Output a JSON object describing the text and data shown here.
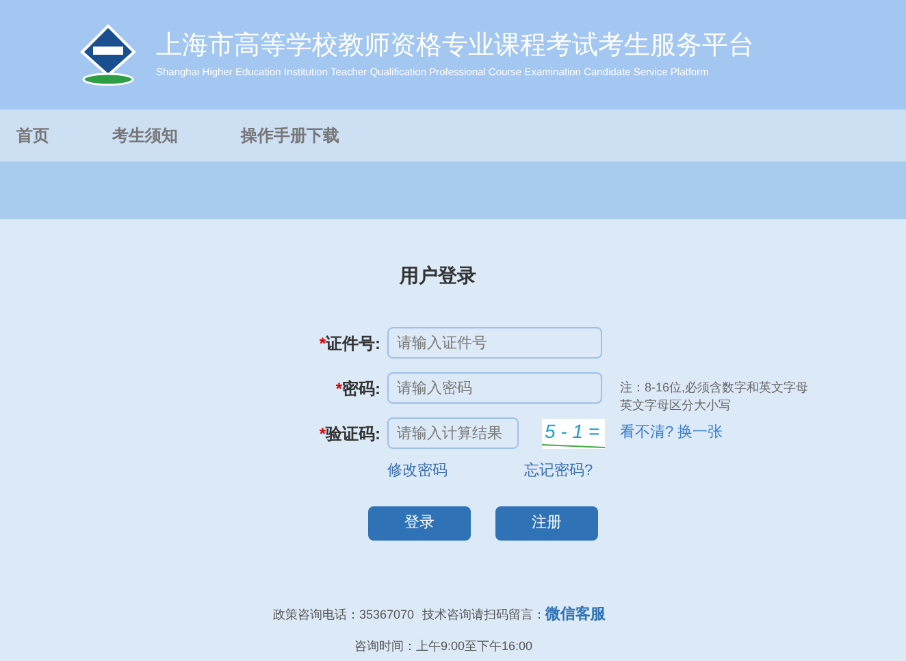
{
  "header": {
    "title": "上海市高等学校教师资格专业课程考试考生服务平台",
    "subtitle": "Shanghai Higher Education Institution Teacher Qualification Professional Course Examination Candidate Service Platform"
  },
  "nav": [
    {
      "label": "首页",
      "selected": false
    },
    {
      "label": "考生须知",
      "selected": false
    },
    {
      "label": "操作手册下载",
      "selected": false
    }
  ],
  "login": {
    "title": "用户登录",
    "fields": [
      {
        "kind": "text",
        "required_mark": "*",
        "label": "证件号:",
        "placeholder": "请输入证件号"
      },
      {
        "kind": "password",
        "required_mark": "*",
        "label": "密码:",
        "placeholder": "请输入密码",
        "note": [
          "注：8-16位,必须含数字和英文字母",
          "英文字母区分大小写"
        ]
      },
      {
        "kind": "captcha",
        "required_mark": "*",
        "label": "验证码:",
        "placeholder": "请输入计算结果",
        "captcha": "5 - 1 =",
        "refresh": "看不清? 换一张"
      }
    ],
    "links": [
      "修改密码",
      "忘记密码?"
    ],
    "buttons": [
      "登录",
      "注册"
    ]
  },
  "footer": {
    "phone_label": "政策咨询电话：35367070",
    "tech_label": "技术咨询请扫码留言：",
    "tech_link": "微信客服",
    "hours": "咨询时间：上午9:00至下午16:00"
  }
}
